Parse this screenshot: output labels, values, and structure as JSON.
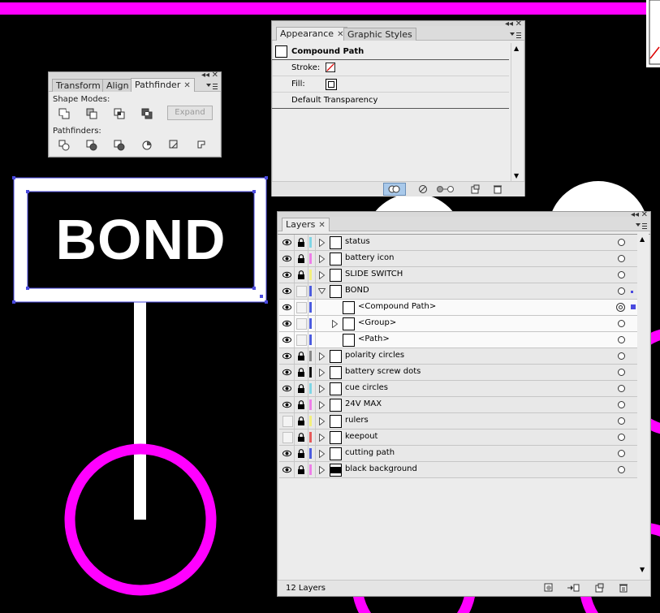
{
  "artwork": {
    "sign_text": "BOND",
    "colors": {
      "magenta": "#ff00ff",
      "white": "#ffffff",
      "black": "#000000",
      "selection": "#4a4adf"
    }
  },
  "pathfinder_panel": {
    "tabs": [
      "Transform",
      "Align",
      "Pathfinder"
    ],
    "active_tab": "Pathfinder",
    "shape_modes_label": "Shape Modes:",
    "pathfinders_label": "Pathfinders:",
    "expand_label": "Expand",
    "shape_mode_icons": [
      "unite-icon",
      "minus-front-icon",
      "intersect-icon",
      "exclude-icon"
    ],
    "pathfinder_icons": [
      "divide-icon",
      "trim-icon",
      "merge-icon",
      "crop-icon",
      "outline-icon",
      "minus-back-icon"
    ]
  },
  "appearance_panel": {
    "tabs": [
      "Appearance",
      "Graphic Styles"
    ],
    "active_tab": "Appearance",
    "title": "Compound Path",
    "stroke_label": "Stroke:",
    "fill_label": "Fill:",
    "transparency_label": "Default Transparency",
    "footer_icons": [
      "new-art-basic-appearance-icon",
      "clear-appearance-icon",
      "reduce-basic-appearance-icon",
      "duplicate-item-icon",
      "delete-item-icon"
    ]
  },
  "layers_panel": {
    "tab": "Layers",
    "footer_count": "12 Layers",
    "footer_icons": [
      "make-clipping-mask-icon",
      "create-sublayer-icon",
      "create-new-layer-icon",
      "trash-icon"
    ],
    "layers": [
      {
        "name": "status",
        "color": "#7fd6e6",
        "locked": true,
        "visible": true,
        "expanded": false,
        "level": 0
      },
      {
        "name": "battery icon",
        "color": "#ee7ee8",
        "locked": true,
        "visible": true,
        "expanded": false,
        "level": 0
      },
      {
        "name": "SLIDE SWITCH",
        "color": "#f4f07c",
        "locked": true,
        "visible": true,
        "expanded": false,
        "level": 0
      },
      {
        "name": "BOND",
        "color": "#4b5bdf",
        "locked": false,
        "visible": true,
        "expanded": true,
        "level": 0
      },
      {
        "name": "<Compound Path>",
        "color": "#4b5bdf",
        "locked": false,
        "visible": true,
        "expanded": false,
        "level": 1,
        "selected": true
      },
      {
        "name": "<Group>",
        "color": "#4b5bdf",
        "locked": false,
        "visible": true,
        "expanded": false,
        "level": 1,
        "has_children": true
      },
      {
        "name": "<Path>",
        "color": "#4b5bdf",
        "locked": false,
        "visible": true,
        "expanded": false,
        "level": 1
      },
      {
        "name": "polarity circles",
        "color": "#888888",
        "locked": true,
        "visible": true,
        "expanded": false,
        "level": 0
      },
      {
        "name": "battery screw dots",
        "color": "#111111",
        "locked": true,
        "visible": true,
        "expanded": false,
        "level": 0
      },
      {
        "name": "cue circles",
        "color": "#7fd6e6",
        "locked": true,
        "visible": true,
        "expanded": false,
        "level": 0
      },
      {
        "name": "24V MAX",
        "color": "#ee7ee8",
        "locked": true,
        "visible": true,
        "expanded": false,
        "level": 0
      },
      {
        "name": "rulers",
        "color": "#f4f07c",
        "locked": true,
        "visible": false,
        "expanded": false,
        "level": 0
      },
      {
        "name": "keepout",
        "color": "#e65a5a",
        "locked": true,
        "visible": false,
        "expanded": false,
        "level": 0
      },
      {
        "name": "cutting path",
        "color": "#4b5bdf",
        "locked": true,
        "visible": true,
        "expanded": false,
        "level": 0
      },
      {
        "name": "black background",
        "color": "#ee7ee8",
        "locked": true,
        "visible": true,
        "expanded": false,
        "level": 0
      }
    ]
  }
}
